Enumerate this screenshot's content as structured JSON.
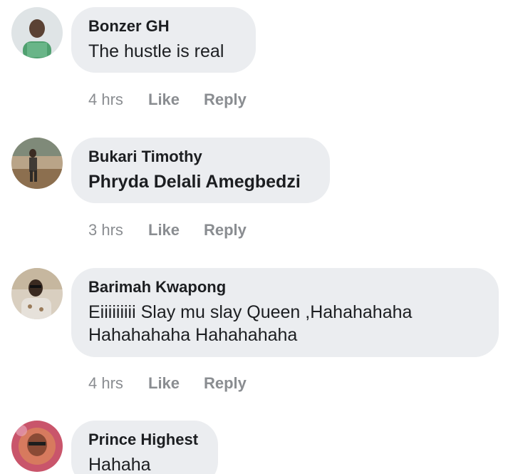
{
  "comments": [
    {
      "author": "Bonzer GH",
      "text": "The hustle is real",
      "time": "4 hrs",
      "like_label": "Like",
      "reply_label": "Reply"
    },
    {
      "author": "Bukari Timothy",
      "text": "Phryda Delali Amegbedzi",
      "time": "3 hrs",
      "like_label": "Like",
      "reply_label": "Reply"
    },
    {
      "author": "Barimah Kwapong",
      "text_line1": "Eiiiiiiiii Slay mu slay Queen ,Hahahahaha",
      "text_line2": "Hahahahaha Hahahahaha",
      "time": "4 hrs",
      "like_label": "Like",
      "reply_label": "Reply"
    },
    {
      "author": "Prince Highest",
      "text": "Hahaha"
    }
  ],
  "colors": {
    "bubble_bg": "#ebedf0",
    "text": "#1c1e21",
    "meta": "#8a8d91"
  }
}
